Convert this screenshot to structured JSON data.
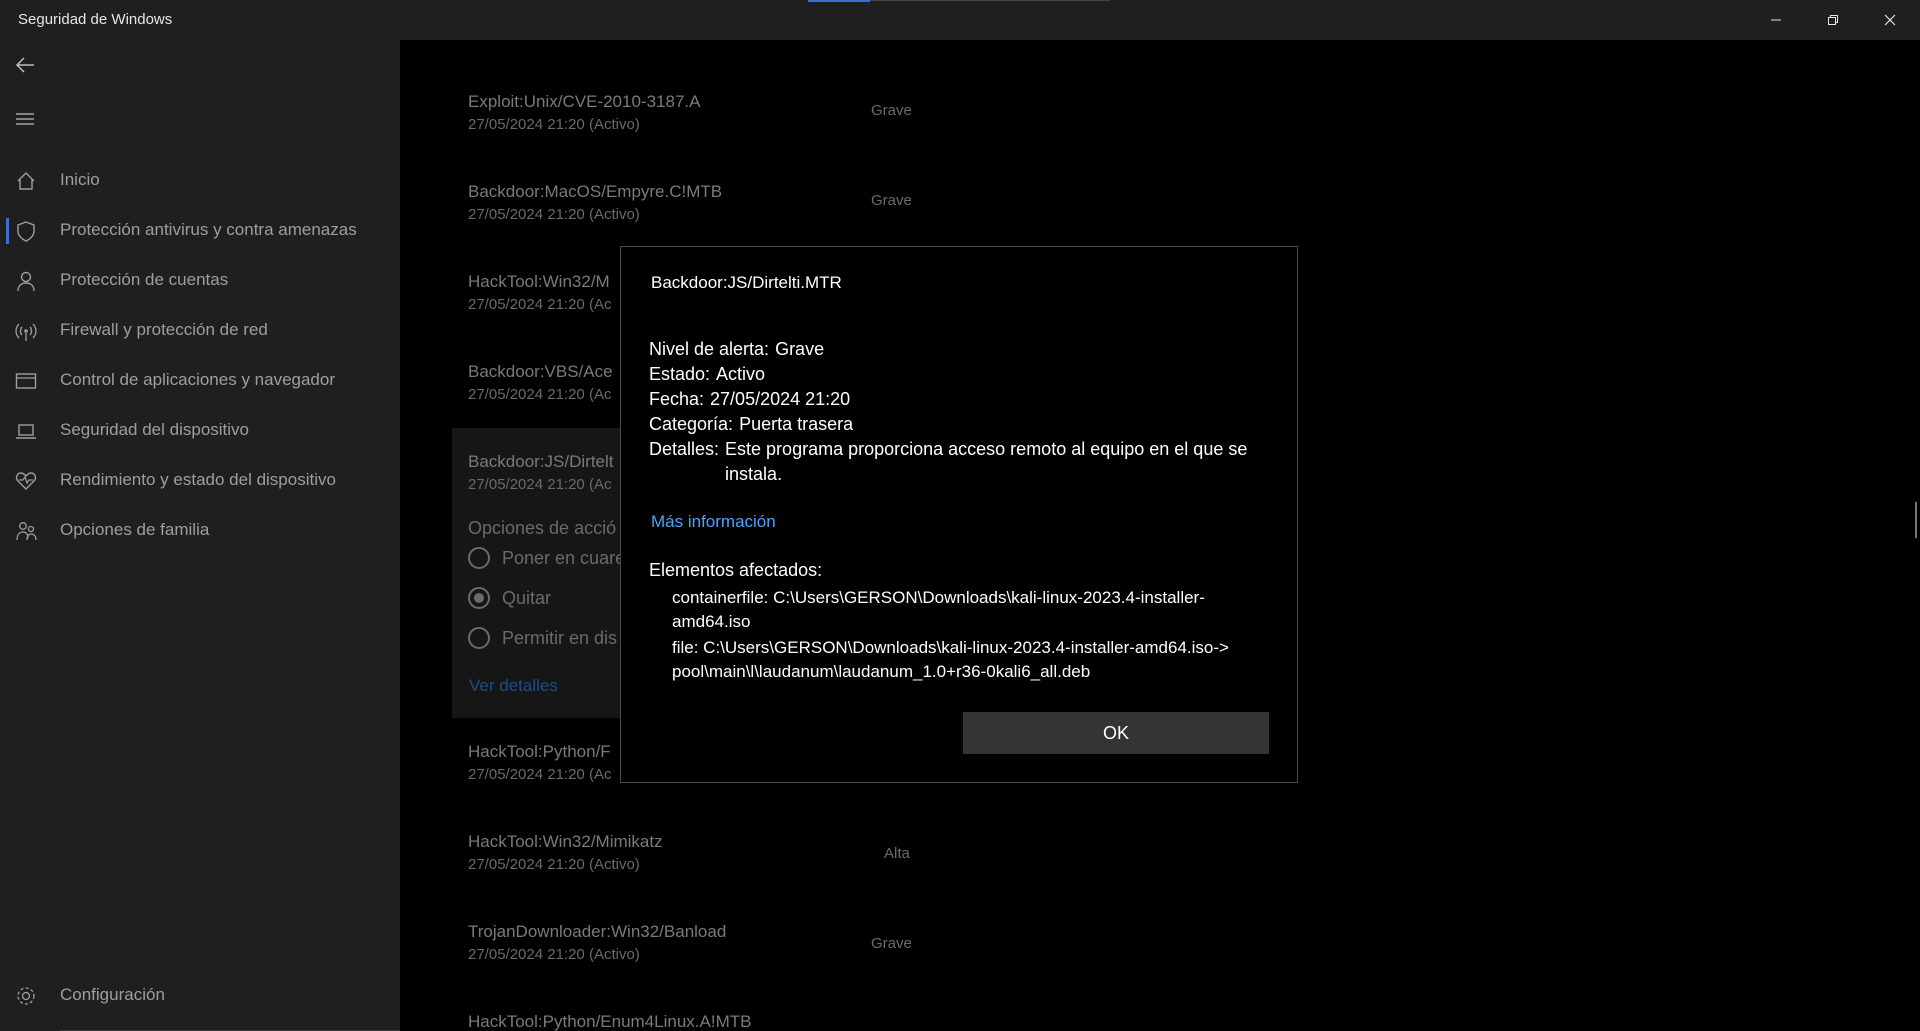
{
  "window": {
    "title": "Seguridad de Windows",
    "minimize_icon": "minimize-icon",
    "maximize_icon": "restore-icon",
    "close_icon": "close-icon"
  },
  "sidebar": {
    "back_icon": "back-arrow-icon",
    "menu_icon": "hamburger-menu-icon",
    "items": [
      {
        "label": "Inicio",
        "icon": "home-icon"
      },
      {
        "label": "Protección antivirus y contra amenazas",
        "icon": "shield-icon",
        "active": true
      },
      {
        "label": "Protección de cuentas",
        "icon": "person-icon"
      },
      {
        "label": "Firewall y protección de red",
        "icon": "wireless-icon"
      },
      {
        "label": "Control de aplicaciones y navegador",
        "icon": "browser-window-icon"
      },
      {
        "label": "Seguridad del dispositivo",
        "icon": "laptop-icon"
      },
      {
        "label": "Rendimiento y estado del dispositivo",
        "icon": "heart-pulse-icon"
      },
      {
        "label": "Opciones de familia",
        "icon": "family-icon"
      }
    ],
    "settings": {
      "label": "Configuración",
      "icon": "gear-icon"
    },
    "accent_color": "#3b6fd1"
  },
  "threats": [
    {
      "name": "Exploit:Unix/CVE-2010-3187.A",
      "meta": "27/05/2024 21:20 (Activo)",
      "severity": "Grave"
    },
    {
      "name": "Backdoor:MacOS/Empyre.C!MTB",
      "meta": "27/05/2024 21:20 (Activo)",
      "severity": "Grave"
    },
    {
      "name": "HackTool:Win32/M",
      "meta": "27/05/2024 21:20 (Ac",
      "severity": ""
    },
    {
      "name": "Backdoor:VBS/Ace",
      "meta": "27/05/2024 21:20 (Ac",
      "severity": ""
    },
    {
      "name": "Backdoor:JS/Dirtelt",
      "meta": "27/05/2024 21:20 (Ac",
      "severity": ""
    },
    {
      "name": "HackTool:Python/F",
      "meta": "27/05/2024 21:20 (Ac",
      "severity": ""
    },
    {
      "name": "HackTool:Win32/Mimikatz",
      "meta": "27/05/2024 21:20 (Activo)",
      "severity": "Alta"
    },
    {
      "name": "TrojanDownloader:Win32/Banload",
      "meta": "27/05/2024 21:20 (Activo)",
      "severity": "Grave"
    },
    {
      "name": "HackTool:Python/Enum4Linux.A!MTB",
      "meta": "",
      "severity": ""
    }
  ],
  "actions": {
    "title": "Opciones de acció",
    "options": [
      {
        "label": "Poner en cuare",
        "checked": false
      },
      {
        "label": "Quitar",
        "checked": true
      },
      {
        "label": "Permitir en dis",
        "checked": false
      }
    ],
    "details_link": "Ver detalles"
  },
  "dialog": {
    "title": "Backdoor:JS/Dirtelti.MTR",
    "fields": [
      {
        "key": "Nivel de alerta:",
        "value": "Grave"
      },
      {
        "key": "Estado:",
        "value": "Activo"
      },
      {
        "key": "Fecha:",
        "value": "27/05/2024 21:20"
      },
      {
        "key": "Categoría:",
        "value": "Puerta trasera"
      },
      {
        "key": "Detalles:",
        "value": "Este programa proporciona acceso remoto al equipo en el que se instala."
      }
    ],
    "more_info": "Más información",
    "affected_title": "Elementos afectados:",
    "affected": [
      "containerfile: C:\\Users\\GERSON\\Downloads\\kali-linux-2023.4-installer-amd64.iso",
      "file: C:\\Users\\GERSON\\Downloads\\kali-linux-2023.4-installer-amd64.iso->pool\\main\\l\\laudanum\\laudanum_1.0+r36-0kali6_all.deb"
    ],
    "ok_label": "OK",
    "link_color": "#4aa3ff"
  }
}
